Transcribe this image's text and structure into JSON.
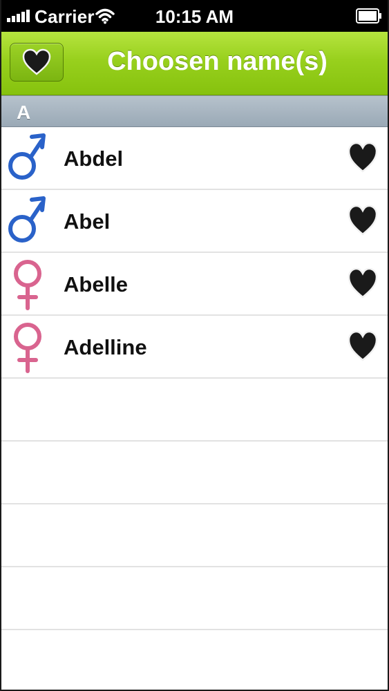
{
  "status_bar": {
    "carrier": "Carrier",
    "time": "10:15 AM"
  },
  "nav": {
    "title": "Choosen name(s)",
    "button_icon": "heart-icon"
  },
  "section": {
    "letter": "A"
  },
  "names": [
    {
      "name": "Abdel",
      "gender": "male",
      "favorite": true
    },
    {
      "name": "Abel",
      "gender": "male",
      "favorite": true
    },
    {
      "name": "Abelle",
      "gender": "female",
      "favorite": true
    },
    {
      "name": "Adelline",
      "gender": "female",
      "favorite": true
    }
  ],
  "colors": {
    "nav_green": "#98d01d",
    "male_blue": "#2a62c9",
    "female_pink": "#d9648f",
    "heart": "#1a1a1a"
  }
}
